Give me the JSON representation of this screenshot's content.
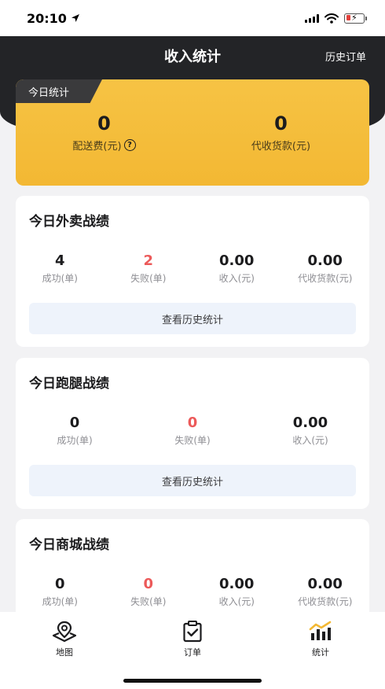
{
  "status_bar": {
    "time": "20:10"
  },
  "header": {
    "title": "收入统计",
    "right_link": "历史订单"
  },
  "today": {
    "tag": "今日统计",
    "delivery_fee": {
      "value": "0",
      "label": "配送费(元)"
    },
    "cod": {
      "value": "0",
      "label": "代收货款(元)"
    }
  },
  "takeout": {
    "title": "今日外卖战绩",
    "stats": [
      {
        "value": "4",
        "label": "成功(单)"
      },
      {
        "value": "2",
        "label": "失败(单)"
      },
      {
        "value": "0.00",
        "label": "收入(元)"
      },
      {
        "value": "0.00",
        "label": "代收货款(元)"
      }
    ],
    "button": "查看历史统计"
  },
  "errand": {
    "title": "今日跑腿战绩",
    "stats": [
      {
        "value": "0",
        "label": "成功(单)"
      },
      {
        "value": "0",
        "label": "失败(单)"
      },
      {
        "value": "0.00",
        "label": "收入(元)"
      }
    ],
    "button": "查看历史统计"
  },
  "mall": {
    "title": "今日商城战绩",
    "stats": [
      {
        "value": "0",
        "label": "成功(单)"
      },
      {
        "value": "0",
        "label": "失败(单)"
      },
      {
        "value": "0.00",
        "label": "收入(元)"
      },
      {
        "value": "0.00",
        "label": "代收货款(元)"
      }
    ]
  },
  "tabs": [
    {
      "label": "地图",
      "icon": "map-pin-icon"
    },
    {
      "label": "订单",
      "icon": "clipboard-check-icon"
    },
    {
      "label": "统计",
      "icon": "bar-chart-icon"
    }
  ],
  "colors": {
    "accent": "#f3b833",
    "header": "#232427",
    "fail": "#ec5a5a"
  }
}
